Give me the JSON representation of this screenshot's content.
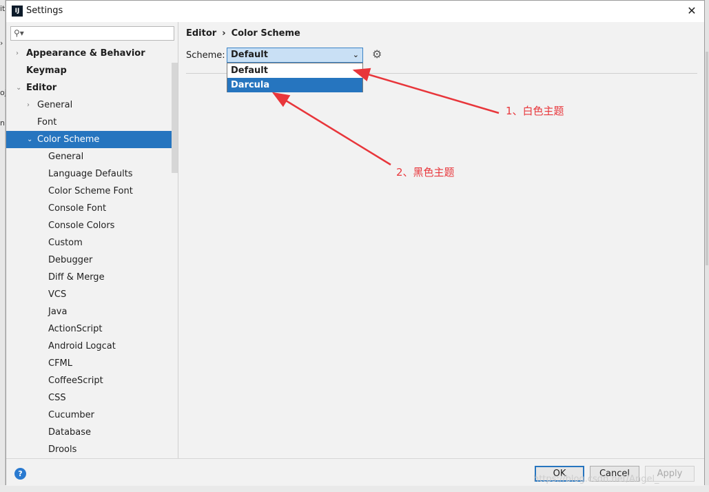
{
  "window": {
    "title": "Settings",
    "app_icon_text": "IJ"
  },
  "search": {
    "placeholder": ""
  },
  "sidebar": {
    "items": [
      {
        "label": "Appearance & Behavior",
        "bold": true,
        "arrow": "›",
        "level": 0
      },
      {
        "label": "Keymap",
        "bold": true,
        "arrow": "",
        "level": 0
      },
      {
        "label": "Editor",
        "bold": true,
        "arrow": "⌄",
        "level": 0
      },
      {
        "label": "General",
        "bold": false,
        "arrow": "›",
        "level": 1
      },
      {
        "label": "Font",
        "bold": false,
        "arrow": "",
        "level": 1
      },
      {
        "label": "Color Scheme",
        "bold": false,
        "arrow": "⌄",
        "level": 1,
        "selected": true
      },
      {
        "label": "General",
        "bold": false,
        "arrow": "",
        "level": 2
      },
      {
        "label": "Language Defaults",
        "bold": false,
        "arrow": "",
        "level": 2
      },
      {
        "label": "Color Scheme Font",
        "bold": false,
        "arrow": "",
        "level": 2
      },
      {
        "label": "Console Font",
        "bold": false,
        "arrow": "",
        "level": 2
      },
      {
        "label": "Console Colors",
        "bold": false,
        "arrow": "",
        "level": 2
      },
      {
        "label": "Custom",
        "bold": false,
        "arrow": "",
        "level": 2
      },
      {
        "label": "Debugger",
        "bold": false,
        "arrow": "",
        "level": 2
      },
      {
        "label": "Diff & Merge",
        "bold": false,
        "arrow": "",
        "level": 2
      },
      {
        "label": "VCS",
        "bold": false,
        "arrow": "",
        "level": 2
      },
      {
        "label": "Java",
        "bold": false,
        "arrow": "",
        "level": 2
      },
      {
        "label": "ActionScript",
        "bold": false,
        "arrow": "",
        "level": 2
      },
      {
        "label": "Android Logcat",
        "bold": false,
        "arrow": "",
        "level": 2
      },
      {
        "label": "CFML",
        "bold": false,
        "arrow": "",
        "level": 2
      },
      {
        "label": "CoffeeScript",
        "bold": false,
        "arrow": "",
        "level": 2
      },
      {
        "label": "CSS",
        "bold": false,
        "arrow": "",
        "level": 2
      },
      {
        "label": "Cucumber",
        "bold": false,
        "arrow": "",
        "level": 2
      },
      {
        "label": "Database",
        "bold": false,
        "arrow": "",
        "level": 2
      },
      {
        "label": "Drools",
        "bold": false,
        "arrow": "",
        "level": 2
      }
    ]
  },
  "breadcrumb": {
    "parent": "Editor",
    "separator": "›",
    "current": "Color Scheme"
  },
  "scheme": {
    "label": "Scheme:",
    "selected": "Default",
    "options": [
      "Default",
      "Darcula"
    ],
    "highlighted": "Darcula"
  },
  "annotations": {
    "first": "1、白色主题",
    "second": "2、黑色主题"
  },
  "footer": {
    "help": "?",
    "ok": "OK",
    "cancel": "Cancel",
    "apply": "Apply"
  },
  "watermark": "https://blog.csdn.net/Angel_",
  "colors": {
    "accent": "#2675bf",
    "annotation": "#e8363b"
  }
}
